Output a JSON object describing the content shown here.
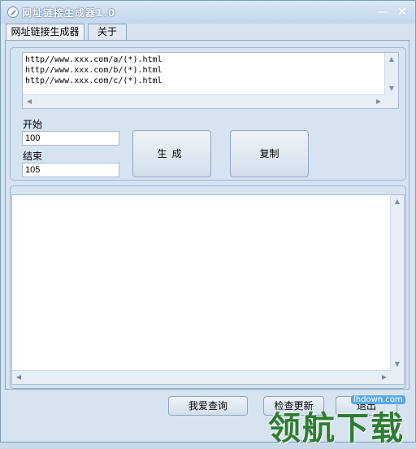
{
  "window": {
    "title": "网址链接生成器1.0",
    "min_glyph": "—",
    "close_glyph": "✕"
  },
  "tabs": [
    {
      "label": "网址链接生成器",
      "selected": true
    },
    {
      "label": "关于",
      "selected": false
    }
  ],
  "url_templates": {
    "lines": "http//www.xxx.com/a/(*).html\nhttp//www.xxx.com/b/(*).html\nhttp//www.xxx.com/c/(*).html"
  },
  "range": {
    "start_label": "开始",
    "start_value": "100",
    "end_label": "结束",
    "end_value": "105"
  },
  "buttons": {
    "generate": "生成",
    "copy": "复制",
    "query": "我爱查询",
    "update": "检查更新",
    "exit": "退出"
  },
  "watermark": {
    "text": "领航下载",
    "site": "lhdown.com"
  },
  "scroll_glyphs": {
    "up": "▲",
    "down": "▼",
    "left": "◀",
    "right": "▶"
  },
  "colors": {
    "window_bg": "#d6e3f1",
    "border": "#8ea6c0",
    "watermark": "#2e7d32"
  }
}
